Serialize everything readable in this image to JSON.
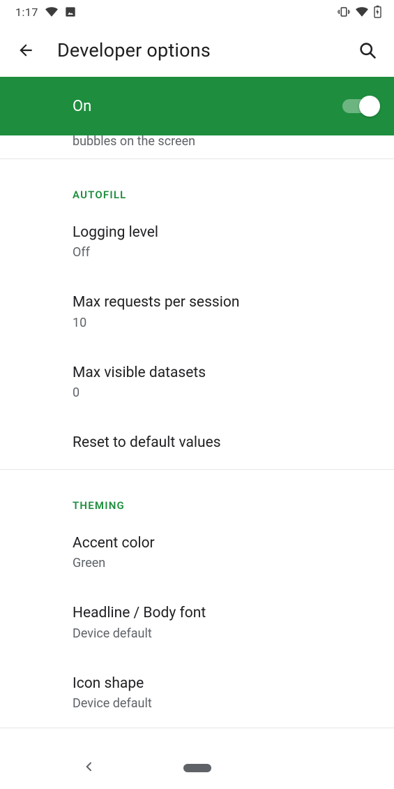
{
  "status_bar": {
    "time": "1:17"
  },
  "app_bar": {
    "title": "Developer options"
  },
  "master_switch": {
    "label": "On",
    "enabled": true
  },
  "partial_item_text": "bubbles on the screen",
  "sections": {
    "autofill": {
      "header": "Autofill",
      "items": {
        "logging_level": {
          "title": "Logging level",
          "value": "Off"
        },
        "max_requests": {
          "title": "Max requests per session",
          "value": "10"
        },
        "max_datasets": {
          "title": "Max visible datasets",
          "value": "0"
        },
        "reset": {
          "title": "Reset to default values"
        }
      }
    },
    "theming": {
      "header": "Theming",
      "items": {
        "accent_color": {
          "title": "Accent color",
          "value": "Green"
        },
        "font": {
          "title": "Headline / Body font",
          "value": "Device default"
        },
        "icon_shape": {
          "title": "Icon shape",
          "value": "Device default"
        }
      }
    }
  }
}
